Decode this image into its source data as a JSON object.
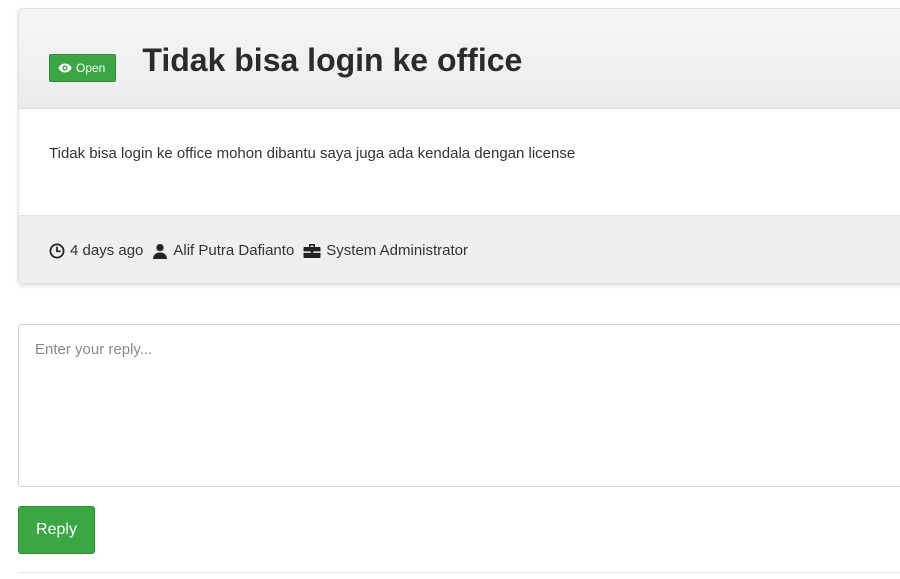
{
  "ticket": {
    "status": "Open",
    "title": "Tidak bisa login ke office",
    "body": "Tidak bisa login ke office mohon dibantu saya juga ada kendala dengan license",
    "time": "4 days ago",
    "author": "Alif Putra Dafianto",
    "role": "System Administrator"
  },
  "reply": {
    "placeholder": "Enter your reply...",
    "button_label": "Reply"
  },
  "icons": {
    "status": "eye-icon",
    "time": "clock-icon",
    "author": "user-icon",
    "role": "briefcase-icon"
  },
  "colors": {
    "accent_green": "#3aa644",
    "header_bg": "#ececec",
    "footer_bg": "#efefef"
  }
}
